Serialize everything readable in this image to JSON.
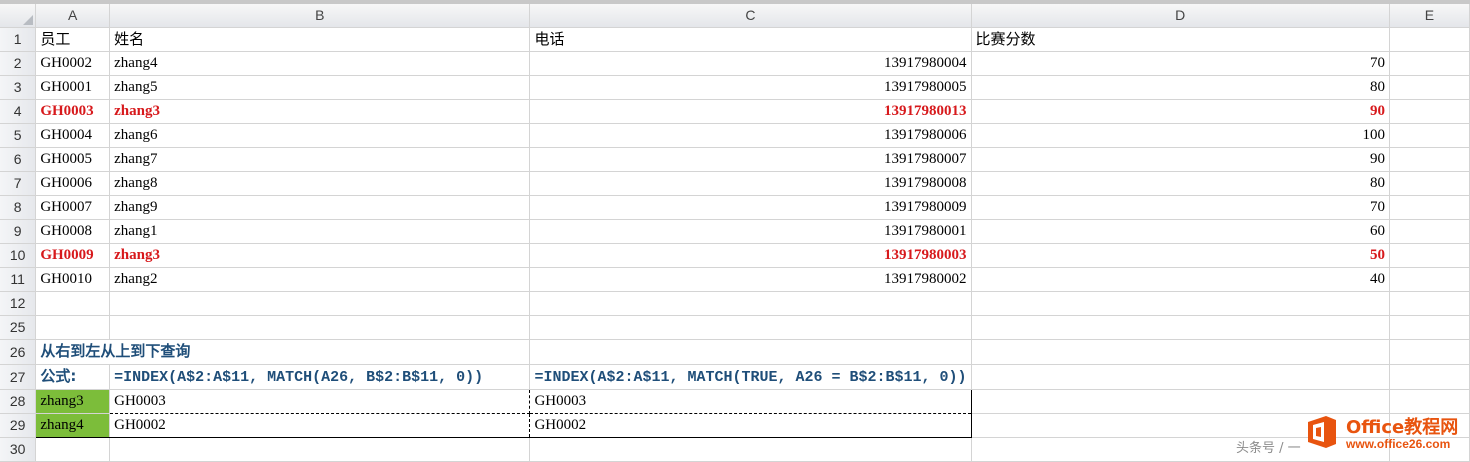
{
  "columns": [
    "A",
    "B",
    "C",
    "D",
    "E"
  ],
  "rows": [
    {
      "num": "1",
      "a": "员工",
      "b": "姓名",
      "c": "电话",
      "d": "比赛分数",
      "style": "plain"
    },
    {
      "num": "2",
      "a": "GH0002",
      "b": "zhang4",
      "c": "13917980004",
      "d": "70",
      "style": "plain"
    },
    {
      "num": "3",
      "a": "GH0001",
      "b": "zhang5",
      "c": "13917980005",
      "d": "80",
      "style": "plain"
    },
    {
      "num": "4",
      "a": "GH0003",
      "b": "zhang3",
      "c": "13917980013",
      "d": "90",
      "style": "red"
    },
    {
      "num": "5",
      "a": "GH0004",
      "b": "zhang6",
      "c": "13917980006",
      "d": "100",
      "style": "plain"
    },
    {
      "num": "6",
      "a": "GH0005",
      "b": "zhang7",
      "c": "13917980007",
      "d": "90",
      "style": "plain"
    },
    {
      "num": "7",
      "a": "GH0006",
      "b": "zhang8",
      "c": "13917980008",
      "d": "80",
      "style": "plain"
    },
    {
      "num": "8",
      "a": "GH0007",
      "b": "zhang9",
      "c": "13917980009",
      "d": "70",
      "style": "plain"
    },
    {
      "num": "9",
      "a": "GH0008",
      "b": "zhang1",
      "c": "13917980001",
      "d": "60",
      "style": "plain"
    },
    {
      "num": "10",
      "a": "GH0009",
      "b": "zhang3",
      "c": "13917980003",
      "d": "50",
      "style": "red"
    },
    {
      "num": "11",
      "a": "GH0010",
      "b": "zhang2",
      "c": "13917980002",
      "d": "40",
      "style": "plain"
    }
  ],
  "row12": "12",
  "row25": "25",
  "row26": {
    "num": "26",
    "text": "从右到左从上到下查询"
  },
  "row27": {
    "num": "27",
    "label": "公式:",
    "formula1": "=INDEX(A$2:A$11, MATCH(A26, B$2:B$11, 0))",
    "formula2": "=INDEX(A$2:A$11, MATCH(TRUE, A26 = B$2:B$11, 0))"
  },
  "row28": {
    "num": "28",
    "a": "zhang3",
    "b": "GH0003",
    "c": "GH0003"
  },
  "row29": {
    "num": "29",
    "a": "zhang4",
    "b": "GH0002",
    "c": "GH0002"
  },
  "row30": "30",
  "watermark": {
    "text": "头条号 / 一",
    "logo_title": "Office教程网",
    "logo_url": "www.office26.com",
    "logo_icon": "office-logo-icon"
  },
  "colors": {
    "green_fill": "#7cbd3a",
    "red_text": "#d7191c",
    "blue_text": "#1f4e79",
    "logo_orange": "#e8540f"
  }
}
